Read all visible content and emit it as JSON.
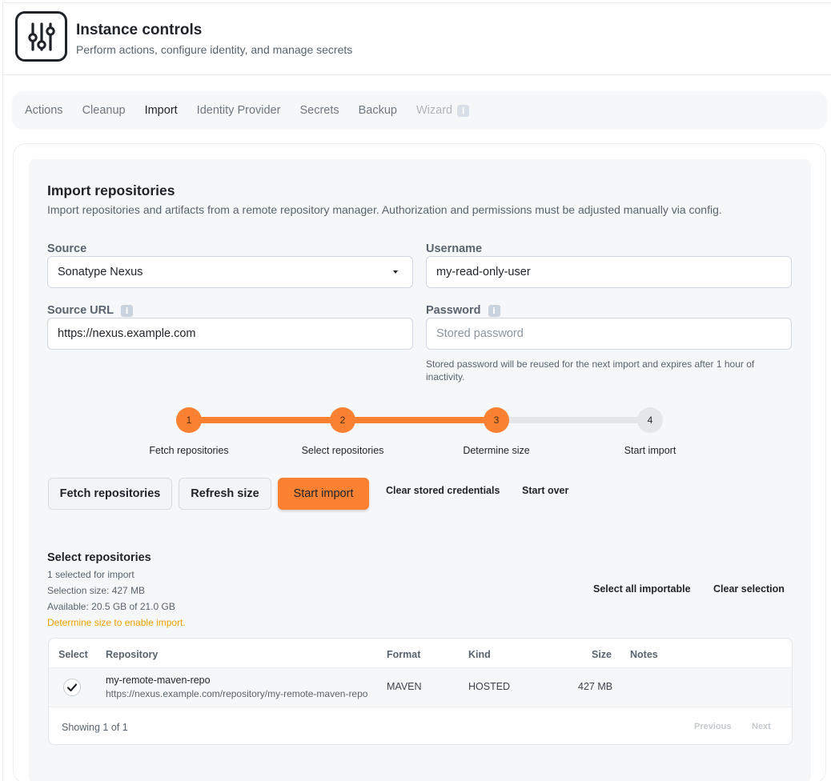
{
  "header": {
    "title": "Instance controls",
    "subtitle": "Perform actions, configure identity, and manage secrets"
  },
  "tabs": [
    {
      "label": "Actions",
      "state": "normal"
    },
    {
      "label": "Cleanup",
      "state": "normal"
    },
    {
      "label": "Import",
      "state": "active"
    },
    {
      "label": "Identity Provider",
      "state": "normal"
    },
    {
      "label": "Secrets",
      "state": "normal"
    },
    {
      "label": "Backup",
      "state": "normal"
    },
    {
      "label": "Wizard",
      "state": "disabled",
      "icon": "info-icon"
    }
  ],
  "import": {
    "title": "Import repositories",
    "description": "Import repositories and artifacts from a remote repository manager. Authorization and permissions must be adjusted manually via config.",
    "source_label": "Source",
    "source_value": "Sonatype Nexus",
    "username_label": "Username",
    "username_value": "my-read-only-user",
    "source_url_label": "Source URL",
    "source_url_value": "https://nexus.example.com",
    "password_label": "Password",
    "password_placeholder": "Stored password",
    "password_hint": "Stored password will be reused for the next import and expires after 1 hour of inactivity."
  },
  "stepper": {
    "steps": [
      {
        "number": "1",
        "label": "Fetch repositories",
        "status": "done"
      },
      {
        "number": "2",
        "label": "Select repositories",
        "status": "done"
      },
      {
        "number": "3",
        "label": "Determine size",
        "status": "done"
      },
      {
        "number": "4",
        "label": "Start import",
        "status": "todo"
      }
    ]
  },
  "actions": {
    "fetch": "Fetch repositories",
    "refresh": "Refresh size",
    "start": "Start import",
    "clear_credentials": "Clear stored credentials",
    "start_over": "Start over"
  },
  "selection": {
    "title": "Select repositories",
    "selected_count": "1 selected for import",
    "selection_size": "Selection size: 427 MB",
    "available": "Available: 20.5 GB of 21.0 GB",
    "warning": "Determine size to enable import.",
    "select_all": "Select all importable",
    "clear": "Clear selection"
  },
  "table": {
    "columns": [
      "Select",
      "Repository",
      "Format",
      "Kind",
      "Size",
      "Notes"
    ],
    "rows": [
      {
        "selected": true,
        "name": "my-remote-maven-repo",
        "url": "https://nexus.example.com/repository/my-remote-maven-repo",
        "format": "MAVEN",
        "kind": "HOSTED",
        "size": "427 MB",
        "notes": ""
      }
    ],
    "footer": "Showing 1 of 1",
    "previous": "Previous",
    "next": "Next"
  },
  "colors": {
    "accent": "#fb8132",
    "warning": "#e9a100"
  }
}
